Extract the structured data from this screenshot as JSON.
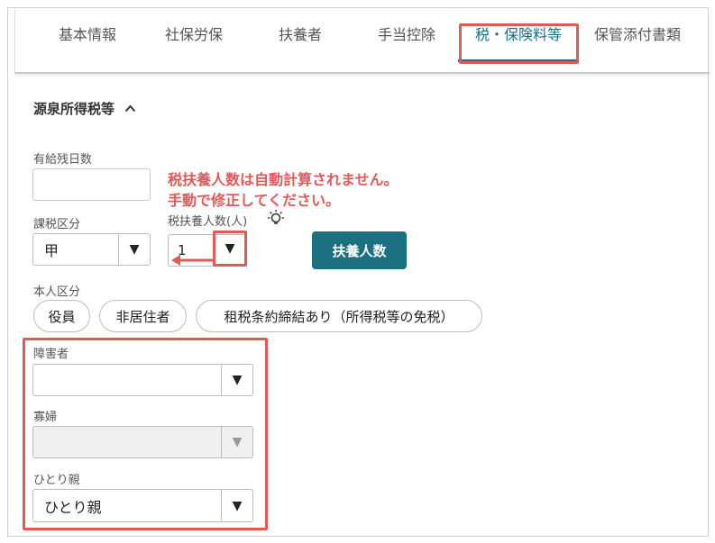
{
  "tabs": [
    {
      "label": "基本情報",
      "active": false
    },
    {
      "label": "社保労保",
      "active": false
    },
    {
      "label": "扶養者",
      "active": false
    },
    {
      "label": "手当控除",
      "active": false
    },
    {
      "label": "税・保険料等",
      "active": true
    },
    {
      "label": "保管添付書類",
      "active": false
    }
  ],
  "section": {
    "title": "源泉所得税等",
    "toggle_icon": "chevron-up-icon"
  },
  "fields": {
    "paid_leave": {
      "label": "有給残日数",
      "value": ""
    },
    "tax_category": {
      "label": "課税区分",
      "value": "甲"
    },
    "dependents": {
      "label": "税扶養人数(人)",
      "value": "1",
      "hint_icon": "lightbulb-icon"
    },
    "disability": {
      "label": "障害者",
      "value": ""
    },
    "widow": {
      "label": "寡婦",
      "value": ""
    },
    "single_parent": {
      "label": "ひとり親",
      "value": "ひとり親"
    }
  },
  "dependents_button": "扶養人数",
  "self_category": {
    "label": "本人区分",
    "chips": [
      "役員",
      "非居住者",
      "租税条約締結あり（所得税等の免税）"
    ]
  },
  "annotation": {
    "line1": "税扶養人数は自動計算されません。",
    "line2": "手動で修正してください。"
  },
  "colors": {
    "accent": "#1d7080",
    "highlight": "#e05a5a"
  }
}
